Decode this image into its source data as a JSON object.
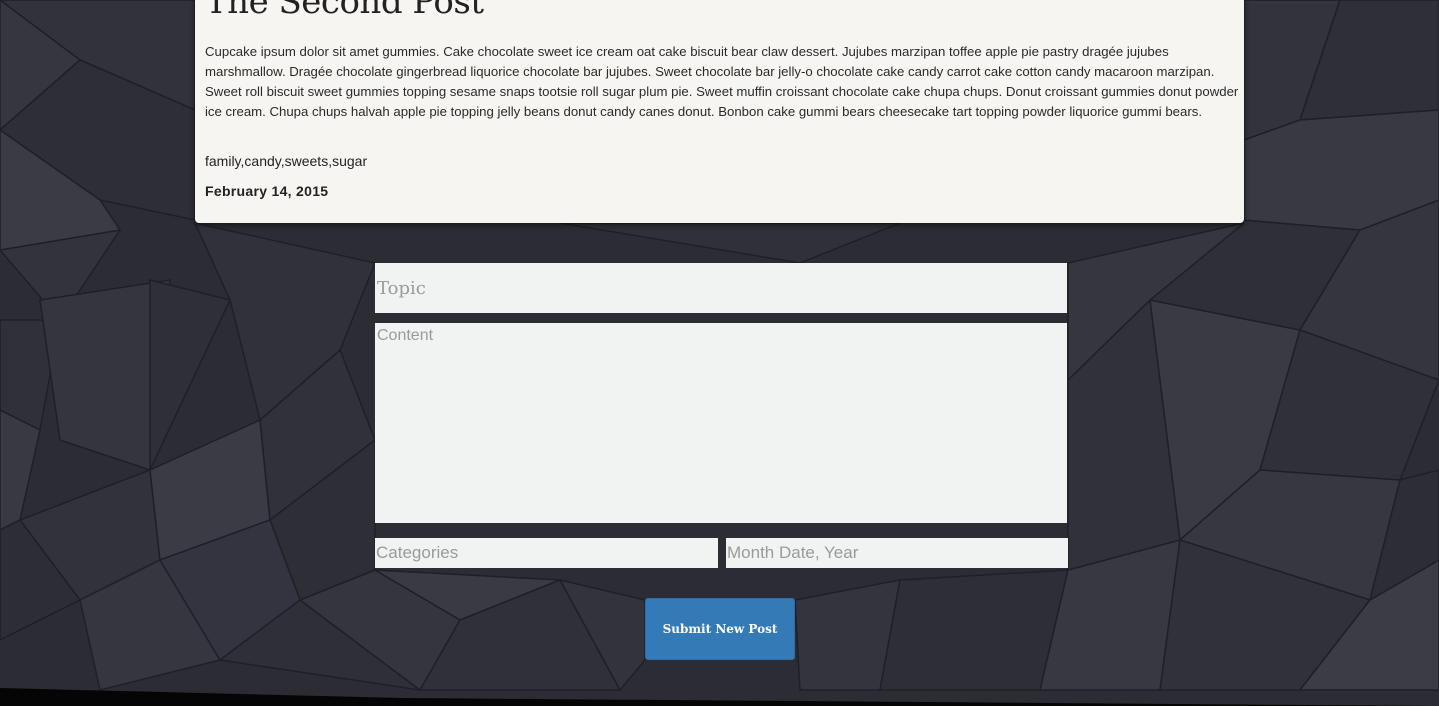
{
  "post": {
    "title": "The Second Post",
    "body": "Cupcake ipsum dolor sit amet gummies. Cake chocolate sweet ice cream oat cake biscuit bear claw dessert. Jujubes marzipan toffee apple pie pastry dragée jujubes marshmallow. Dragée chocolate gingerbread liquorice chocolate bar jujubes. Sweet chocolate bar jelly-o chocolate cake candy carrot cake cotton candy macaroon marzipan. Sweet roll biscuit sweet gummies topping sesame snaps tootsie roll sugar plum pie. Sweet muffin croissant chocolate cake chupa chups. Donut croissant gummies donut powder ice cream. Chupa chups halvah apple pie topping jelly beans donut candy canes donut. Bonbon cake gummi bears cheesecake tart topping powder liquorice gummi bears.",
    "tags": "family,candy,sweets,sugar",
    "date": "February 14, 2015"
  },
  "form": {
    "topic_placeholder": "Topic",
    "content_placeholder": "Content",
    "categories_placeholder": "Categories",
    "date_placeholder": "Month Date, Year",
    "submit_label": "Submit New Post"
  },
  "colors": {
    "background": "#2b2c34",
    "card": "#f7f5f1",
    "field": "#f1f3f2",
    "button": "#337ab7"
  }
}
